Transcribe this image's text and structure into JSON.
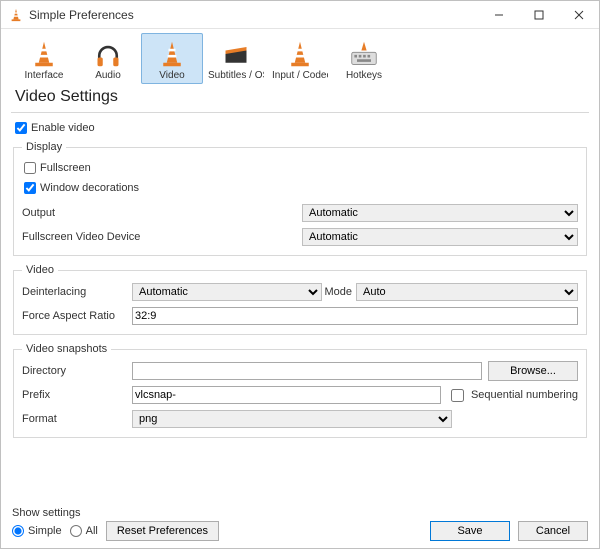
{
  "window": {
    "title": "Simple Preferences"
  },
  "nav": {
    "interface": "Interface",
    "audio": "Audio",
    "video": "Video",
    "subtitles": "Subtitles / OSD",
    "input": "Input / Codecs",
    "hotkeys": "Hotkeys"
  },
  "heading": "Video Settings",
  "enable_video_label": "Enable video",
  "display": {
    "legend": "Display",
    "fullscreen_label": "Fullscreen",
    "window_decorations_label": "Window decorations",
    "output_label": "Output",
    "output_value": "Automatic",
    "fs_device_label": "Fullscreen Video Device",
    "fs_device_value": "Automatic"
  },
  "video": {
    "legend": "Video",
    "deinterlacing_label": "Deinterlacing",
    "deinterlacing_value": "Automatic",
    "mode_label": "Mode",
    "mode_value": "Auto",
    "force_aspect_label": "Force Aspect Ratio",
    "force_aspect_value": "32:9"
  },
  "snapshots": {
    "legend": "Video snapshots",
    "directory_label": "Directory",
    "directory_value": "",
    "browse_label": "Browse...",
    "prefix_label": "Prefix",
    "prefix_value": "vlcsnap-",
    "seq_label": "Sequential numbering",
    "format_label": "Format",
    "format_value": "png"
  },
  "footer": {
    "show_settings_label": "Show settings",
    "simple_label": "Simple",
    "all_label": "All",
    "reset_label": "Reset Preferences",
    "save_label": "Save",
    "cancel_label": "Cancel"
  }
}
